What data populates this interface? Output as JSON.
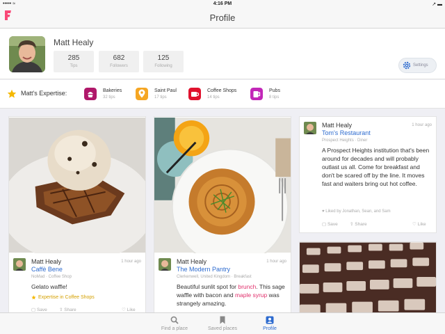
{
  "status_bar": {
    "left": "••••• ≈",
    "time": "4:16 PM",
    "right": "↗ ▬"
  },
  "nav": {
    "title": "Profile"
  },
  "profile": {
    "name": "Matt Healy",
    "stats": [
      {
        "value": "285",
        "label": "Tips"
      },
      {
        "value": "682",
        "label": "Followers"
      },
      {
        "value": "125",
        "label": "Following"
      }
    ],
    "settings_label": "Settings"
  },
  "expertise": {
    "label": "Matt's Expertise:",
    "items": [
      {
        "name": "Bakeries",
        "tips": "32 tips",
        "color": "#b0186a",
        "icon": "cupcake-icon"
      },
      {
        "name": "Saint Paul",
        "tips": "17 tips",
        "color": "#f5a623",
        "icon": "map-pin-icon"
      },
      {
        "name": "Coffee Shops",
        "tips": "14 tips",
        "color": "#e0122e",
        "icon": "coffee-cup-icon"
      },
      {
        "name": "Pubs",
        "tips": "8 tips",
        "color": "#c227b8",
        "icon": "beer-mug-icon"
      }
    ]
  },
  "cards": [
    {
      "user": "Matt Healy",
      "time": "1 hour ago",
      "venue": "Caffè Bene",
      "location": "NoMad · Coffee Shop",
      "tip": "Gelato waffle!",
      "badge": "Expertise in Coffee Shops",
      "save": "Save",
      "share": "Share",
      "like": "Like"
    },
    {
      "user": "Matt Healy",
      "time": "1 hour ago",
      "venue": "The Modern Pantry",
      "location": "Clerkenwell, United Kingdom · Breakfast",
      "tip_parts": [
        "Beautiful sunlit spot for ",
        "brunch",
        ". This sage waffle with bacon and ",
        "maple syrup",
        " was strangely",
        "amazing."
      ]
    },
    {
      "user": "Matt Healy",
      "time": "1 hour ago",
      "venue": "Tom's Restaurant",
      "location": "Prospect Heights · Diner",
      "tip": "A Prospect Heights institution that's been around for decades and will probably outlast us all. Come for breakfast and don't be scared off by the line. It moves fast and waiters bring out hot coffee.",
      "liked": "Liked by Jonathan, Sean, and Sam",
      "save": "Save",
      "share": "Share",
      "like": "Like"
    }
  ],
  "tabs": [
    {
      "label": "Find a place",
      "icon": "search-icon",
      "active": false
    },
    {
      "label": "Saved places",
      "icon": "bookmark-icon",
      "active": false
    },
    {
      "label": "Profile",
      "icon": "profile-icon",
      "active": true
    }
  ],
  "colors": {
    "accent": "#2d6bcf",
    "brand": "#f94877",
    "highlight": "#e1306c",
    "badge": "#d4a000"
  }
}
